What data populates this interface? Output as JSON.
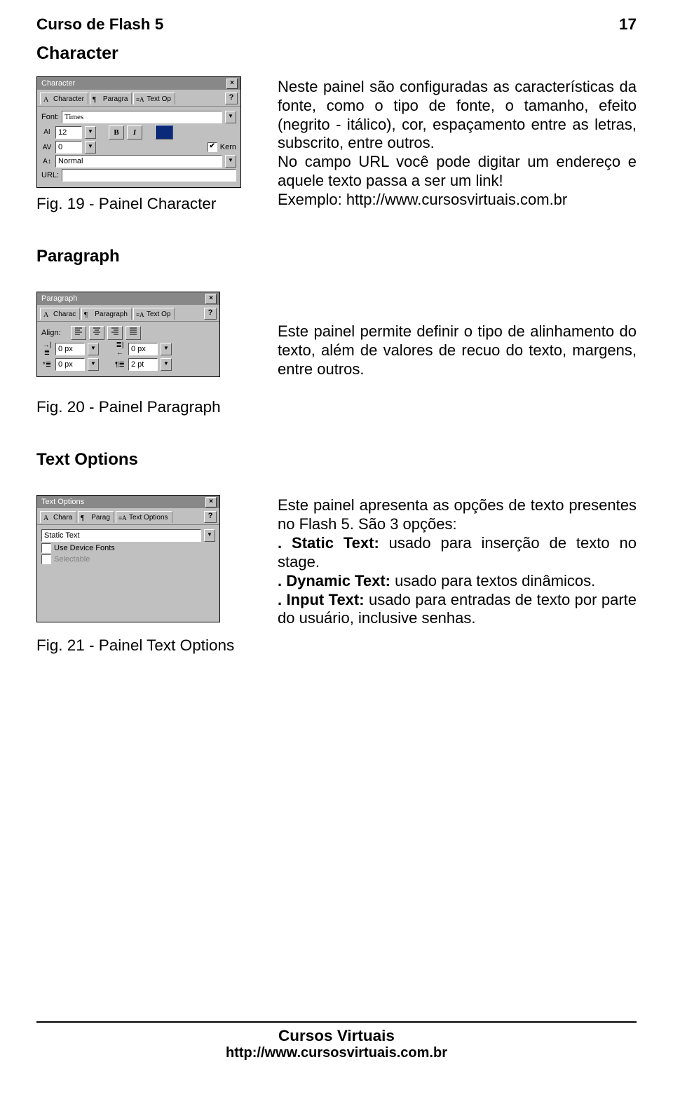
{
  "header": {
    "doc_title": "Curso de Flash 5",
    "page_number": "17"
  },
  "footer": {
    "title": "Cursos Virtuais",
    "url": "http://www.cursosvirtuais.com.br"
  },
  "sections": {
    "character": {
      "title": "Character",
      "caption": "Fig. 19 - Painel Character",
      "body": "Neste painel são configuradas as características da fonte, como o tipo de fonte, o tamanho, efeito (negrito - itálico), cor, espaçamento entre as letras, subscrito, entre outros.\nNo campo URL você pode digitar um endereço e aquele texto passa a ser um link!\nExemplo: http://www.cursosvirtuais.com.br"
    },
    "paragraph": {
      "title": "Paragraph",
      "caption": "Fig. 20 - Painel Paragraph",
      "body": "Este painel permite definir o tipo de alinhamento do texto, além de valores de recuo do texto, margens, entre outros."
    },
    "textoptions": {
      "title": "Text Options",
      "caption": "Fig. 21 - Painel Text Options",
      "intro": "Este painel apresenta as opções de texto presentes no Flash 5. São 3 opções:",
      "opt1_label": ". Static Text:",
      "opt1_text": "  usado para inserção de texto no stage.",
      "opt2_label": ". Dynamic Text:",
      "opt2_text": " usado para textos dinâmicos.",
      "opt3_label": ". Input Text:",
      "opt3_text": " usado para entradas de texto por parte do usuário, inclusive senhas."
    }
  },
  "panel_character": {
    "title": "Character",
    "tabs": [
      "Character",
      "Paragra",
      "Text Op"
    ],
    "help": "?",
    "close": "×",
    "font_label": "Font:",
    "font_value": "Times",
    "size_icon": "AI",
    "size_value": "12",
    "tracking_icon": "AV",
    "tracking_value": "0",
    "kern_label": "Kern",
    "kern_checked": "✔",
    "baseline_icon": "A↕",
    "baseline_value": "Normal",
    "url_label": "URL:",
    "url_value": "",
    "bold": "B",
    "italic": "I"
  },
  "panel_paragraph": {
    "title": "Paragraph",
    "tabs": [
      "Charac",
      "Paragraph",
      "Text Op"
    ],
    "help": "?",
    "close": "×",
    "align_label": "Align:",
    "indent_left": "0 px",
    "indent_right": "0 px",
    "margin_left": "0 px",
    "line_spacing": "2 pt"
  },
  "panel_textoptions": {
    "title": "Text Options",
    "tabs": [
      "Chara",
      "Parag",
      "Text Options"
    ],
    "help": "?",
    "close": "×",
    "type_value": "Static Text",
    "opt_device_fonts": "Use Device Fonts",
    "opt_selectable": "Selectable"
  }
}
